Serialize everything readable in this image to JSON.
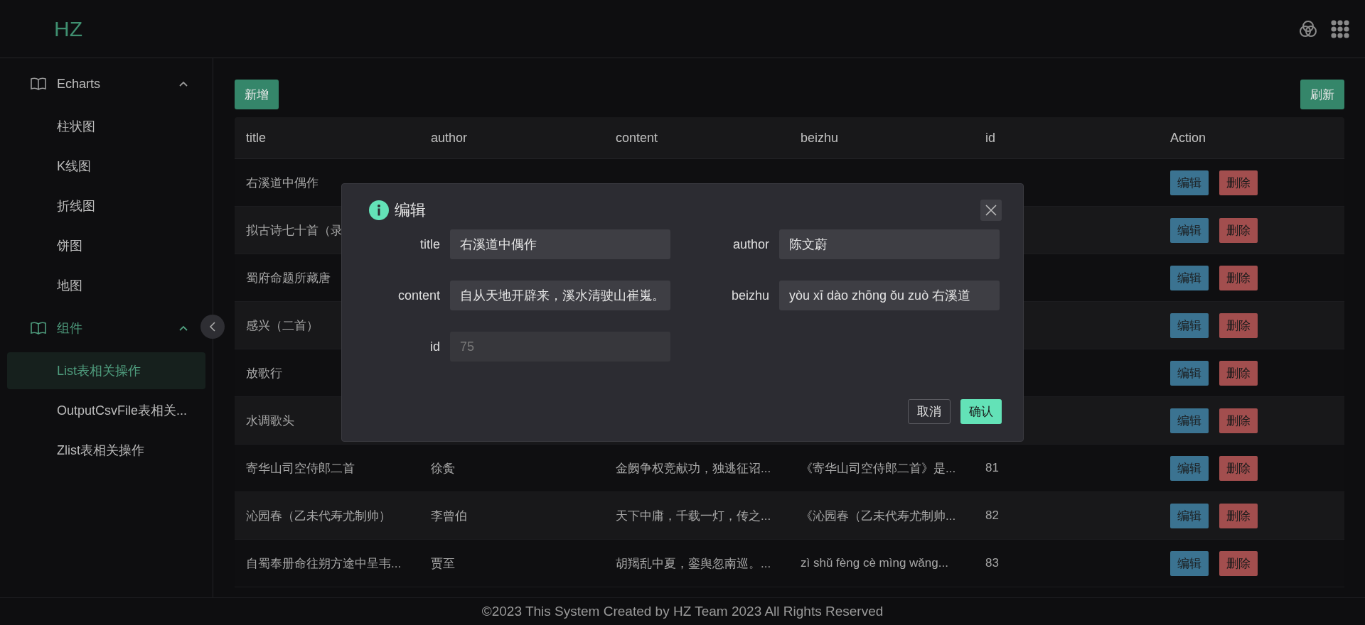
{
  "header": {
    "logo": "HZ"
  },
  "sidebar": {
    "groups": [
      {
        "label": "Echarts",
        "expanded": true,
        "active": false,
        "items": [
          {
            "label": "柱状图",
            "selected": false
          },
          {
            "label": "K线图",
            "selected": false
          },
          {
            "label": "折线图",
            "selected": false
          },
          {
            "label": "饼图",
            "selected": false
          },
          {
            "label": "地图",
            "selected": false
          }
        ]
      },
      {
        "label": "组件",
        "expanded": true,
        "active": true,
        "items": [
          {
            "label": "List表相关操作",
            "selected": true
          },
          {
            "label": "OutputCsvFile表相关...",
            "selected": false
          },
          {
            "label": "Zlist表相关操作",
            "selected": false
          }
        ]
      }
    ]
  },
  "toolbar": {
    "add": "新增",
    "refresh": "刷新"
  },
  "table": {
    "columns": [
      "title",
      "author",
      "content",
      "beizhu",
      "id",
      "Action"
    ],
    "rows": [
      {
        "cells": [
          "右溪道中偶作"
        ],
        "actions": [
          {
            "kind": "edit",
            "label": "编辑"
          },
          {
            "kind": "delete",
            "label": "删除"
          }
        ]
      },
      {
        "cells": [
          "拟古诗七十首（录"
        ],
        "actions": [
          {
            "kind": "edit",
            "label": "编辑"
          },
          {
            "kind": "delete",
            "label": "删除"
          }
        ]
      },
      {
        "cells": [
          "蜀府命题所藏唐"
        ],
        "actions": [
          {
            "kind": "edit",
            "label": "编辑"
          },
          {
            "kind": "delete",
            "label": "删除"
          }
        ]
      },
      {
        "cells": [
          "感兴（二首）"
        ],
        "actions": [
          {
            "kind": "edit",
            "label": "编辑"
          },
          {
            "kind": "delete",
            "label": "删除"
          }
        ]
      },
      {
        "cells": [
          "放歌行"
        ],
        "actions": [
          {
            "kind": "edit",
            "label": "编辑"
          },
          {
            "kind": "delete",
            "label": "删除"
          }
        ]
      },
      {
        "cells": [
          "水调歌头"
        ],
        "actions": [
          {
            "kind": "edit",
            "label": "编辑"
          },
          {
            "kind": "delete",
            "label": "删除"
          }
        ]
      },
      {
        "cells": [
          "寄华山司空侍郎二首",
          "徐夤",
          "金阙争权竞献功，独逃征诏...",
          "《寄华山司空侍郎二首》是...",
          "81"
        ],
        "actions": [
          {
            "kind": "edit",
            "label": "编辑"
          },
          {
            "kind": "delete",
            "label": "删除"
          }
        ]
      },
      {
        "cells": [
          "沁园春（乙未代寿尤制帅）",
          "李曾伯",
          "天下中庸，千载一灯，传之...",
          "《沁园春（乙未代寿尤制帅...",
          "82"
        ],
        "actions": [
          {
            "kind": "edit",
            "label": "编辑"
          },
          {
            "kind": "delete",
            "label": "删除"
          }
        ]
      },
      {
        "cells": [
          "自蜀奉册命往朔方途中呈韦...",
          "贾至",
          "胡羯乱中夏，銮舆忽南巡。...",
          "zì shǔ fèng cè mìng wǎng...",
          "83"
        ],
        "actions": [
          {
            "kind": "edit",
            "label": "编辑"
          },
          {
            "kind": "delete",
            "label": "删除"
          }
        ]
      }
    ]
  },
  "dialog": {
    "title": "编辑",
    "fields": [
      {
        "label": "title",
        "value": "右溪道中偶作",
        "disabled": false
      },
      {
        "label": "author",
        "value": "陈文蔚",
        "disabled": false
      },
      {
        "label": "content",
        "value": "自从天地开辟来，溪水清驶山崔嵬。",
        "disabled": false
      },
      {
        "label": "beizhu",
        "value": "yòu xī dào zhōng ǒu zuò 右溪道",
        "disabled": false
      },
      {
        "label": "id",
        "value": "75",
        "disabled": true
      }
    ],
    "cancel": "取消",
    "confirm": "确认"
  },
  "footer": "©2023 This System Created by HZ Team 2023 All Rights Reserved"
}
